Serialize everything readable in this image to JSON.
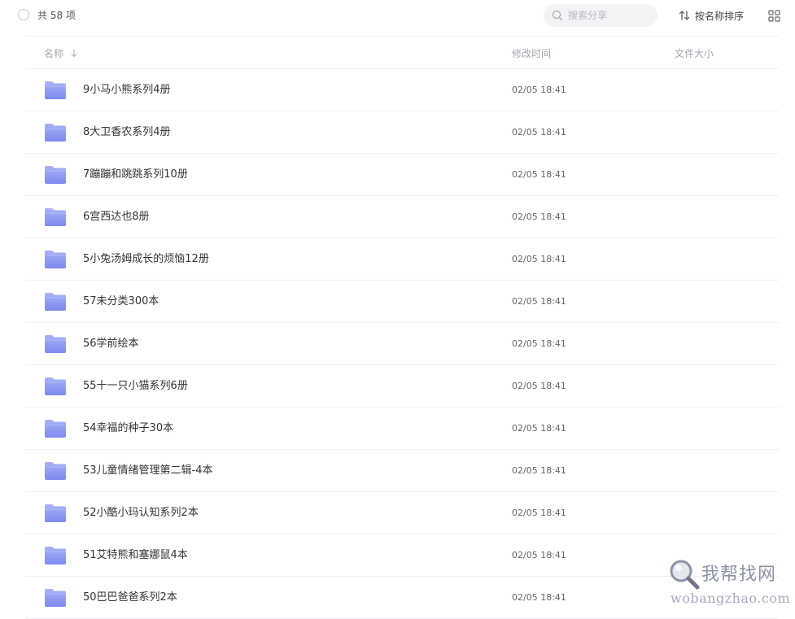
{
  "toolbar": {
    "count_label": "共 58 项",
    "search_placeholder": "搜索分享",
    "sort_label": "按名称排序"
  },
  "columns": {
    "name": "名称",
    "modified": "修改时间",
    "size": "文件大小"
  },
  "files": [
    {
      "name": "9小马小熊系列4册",
      "modified": "02/05 18:41",
      "size": ""
    },
    {
      "name": "8大卫香农系列4册",
      "modified": "02/05 18:41",
      "size": ""
    },
    {
      "name": "7蹦蹦和跳跳系列10册",
      "modified": "02/05 18:41",
      "size": ""
    },
    {
      "name": "6宫西达也8册",
      "modified": "02/05 18:41",
      "size": ""
    },
    {
      "name": "5小兔汤姆成长的烦恼12册",
      "modified": "02/05 18:41",
      "size": ""
    },
    {
      "name": "57未分类300本",
      "modified": "02/05 18:41",
      "size": ""
    },
    {
      "name": "56学前绘本",
      "modified": "02/05 18:41",
      "size": ""
    },
    {
      "name": "55十一只小猫系列6册",
      "modified": "02/05 18:41",
      "size": ""
    },
    {
      "name": "54幸福的种子30本",
      "modified": "02/05 18:41",
      "size": ""
    },
    {
      "name": "53儿童情绪管理第二辑-4本",
      "modified": "02/05 18:41",
      "size": ""
    },
    {
      "name": "52小酷小玛认知系列2本",
      "modified": "02/05 18:41",
      "size": ""
    },
    {
      "name": "51艾特熊和塞娜鼠4本",
      "modified": "02/05 18:41",
      "size": ""
    },
    {
      "name": "50巴巴爸爸系列2本",
      "modified": "02/05 18:41",
      "size": ""
    }
  ],
  "watermark": {
    "title": "我帮找网",
    "domain": "wobangzhao.com"
  },
  "colors": {
    "folder_top": "#a9b3f7",
    "folder_bottom": "#7d88ef",
    "divider": "#eef0f3",
    "header_text": "#a3a7ae"
  }
}
